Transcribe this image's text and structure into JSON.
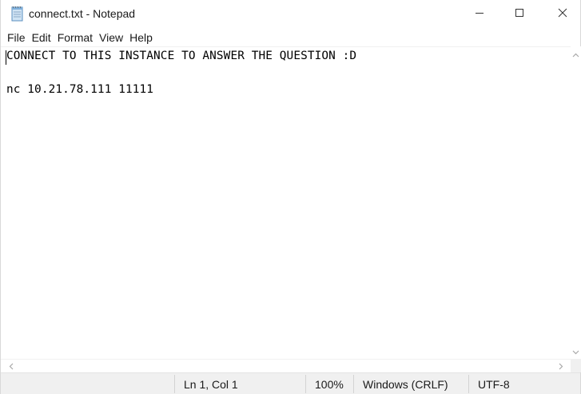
{
  "window": {
    "title": "connect.txt - Notepad",
    "icon": "notepad-icon",
    "controls": [
      "minimize-icon",
      "maximize-icon",
      "close-icon"
    ]
  },
  "menu": {
    "items": [
      {
        "label": "File"
      },
      {
        "label": "Edit"
      },
      {
        "label": "Format"
      },
      {
        "label": "View"
      },
      {
        "label": "Help"
      }
    ]
  },
  "editor": {
    "lines": [
      "CONNECT TO THIS INSTANCE TO ANSWER THE QUESTION :D",
      "",
      "nc 10.21.78.111 11111"
    ]
  },
  "statusbar": {
    "position": "Ln 1, Col 1",
    "zoom": "100%",
    "line_ending": "Windows (CRLF)",
    "encoding": "UTF-8"
  },
  "colors": {
    "status_bg": "#f0f0f0",
    "text": "#000000",
    "scroll_arrow": "#a8a8a8"
  }
}
